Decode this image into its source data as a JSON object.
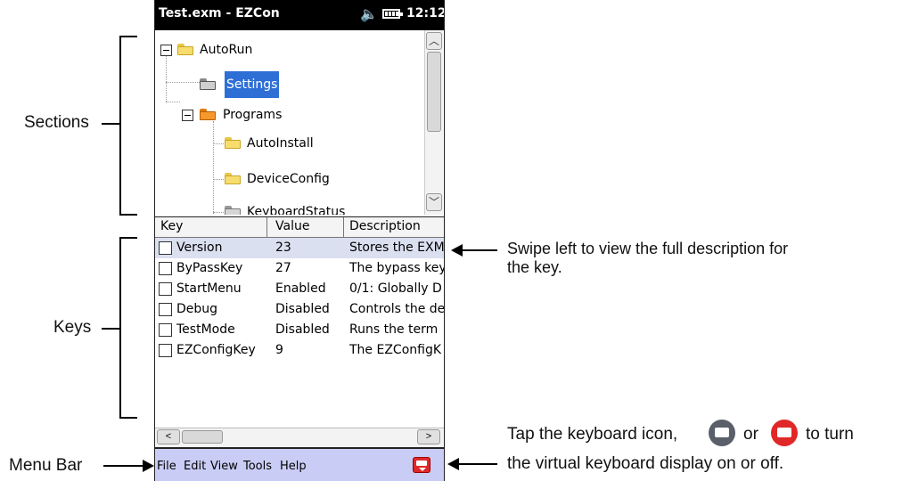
{
  "device": {
    "window_title": "Test.exm - EZCon",
    "time": "12:12"
  },
  "tree": {
    "nodes": [
      {
        "label": "AutoRun"
      },
      {
        "label": "Settings"
      },
      {
        "label": "Programs"
      },
      {
        "label": "AutoInstall"
      },
      {
        "label": "DeviceConfig"
      },
      {
        "label": "KeyboardStatus"
      }
    ]
  },
  "grid": {
    "columns": [
      "Key",
      "Value",
      "Description"
    ],
    "rows": [
      {
        "key": "Version",
        "value": "23",
        "description": "Stores the EXM"
      },
      {
        "key": "ByPassKey",
        "value": "27",
        "description": "The bypass key"
      },
      {
        "key": "StartMenu",
        "value": "Enabled",
        "description": "0/1: Globally D"
      },
      {
        "key": "Debug",
        "value": "Disabled",
        "description": "Controls the de"
      },
      {
        "key": "TestMode",
        "value": "Disabled",
        "description": "Runs the term"
      },
      {
        "key": "EZConfigKey",
        "value": "9",
        "description": "The EZConfigK"
      }
    ]
  },
  "menu": {
    "items": [
      "File",
      "Edit",
      "View",
      "Tools",
      "Help"
    ]
  },
  "annotations": {
    "sections": "Sections",
    "keys": "Keys",
    "menu_bar": "Menu Bar",
    "swipe_line1": "Swipe left to view the full description for",
    "swipe_line2": "the key.",
    "tap_line1_a": "Tap the keyboard icon,",
    "tap_line1_b": "or",
    "tap_line1_c": "to turn",
    "tap_line2": "the virtual keyboard display on or off."
  },
  "colors": {
    "selection": "#2e6fd6",
    "menubar": "#c9cdf5",
    "keyboard_red": "#e02828",
    "keyboard_gray": "#5a5f6a",
    "row_highlight": "#dbe0f0"
  }
}
